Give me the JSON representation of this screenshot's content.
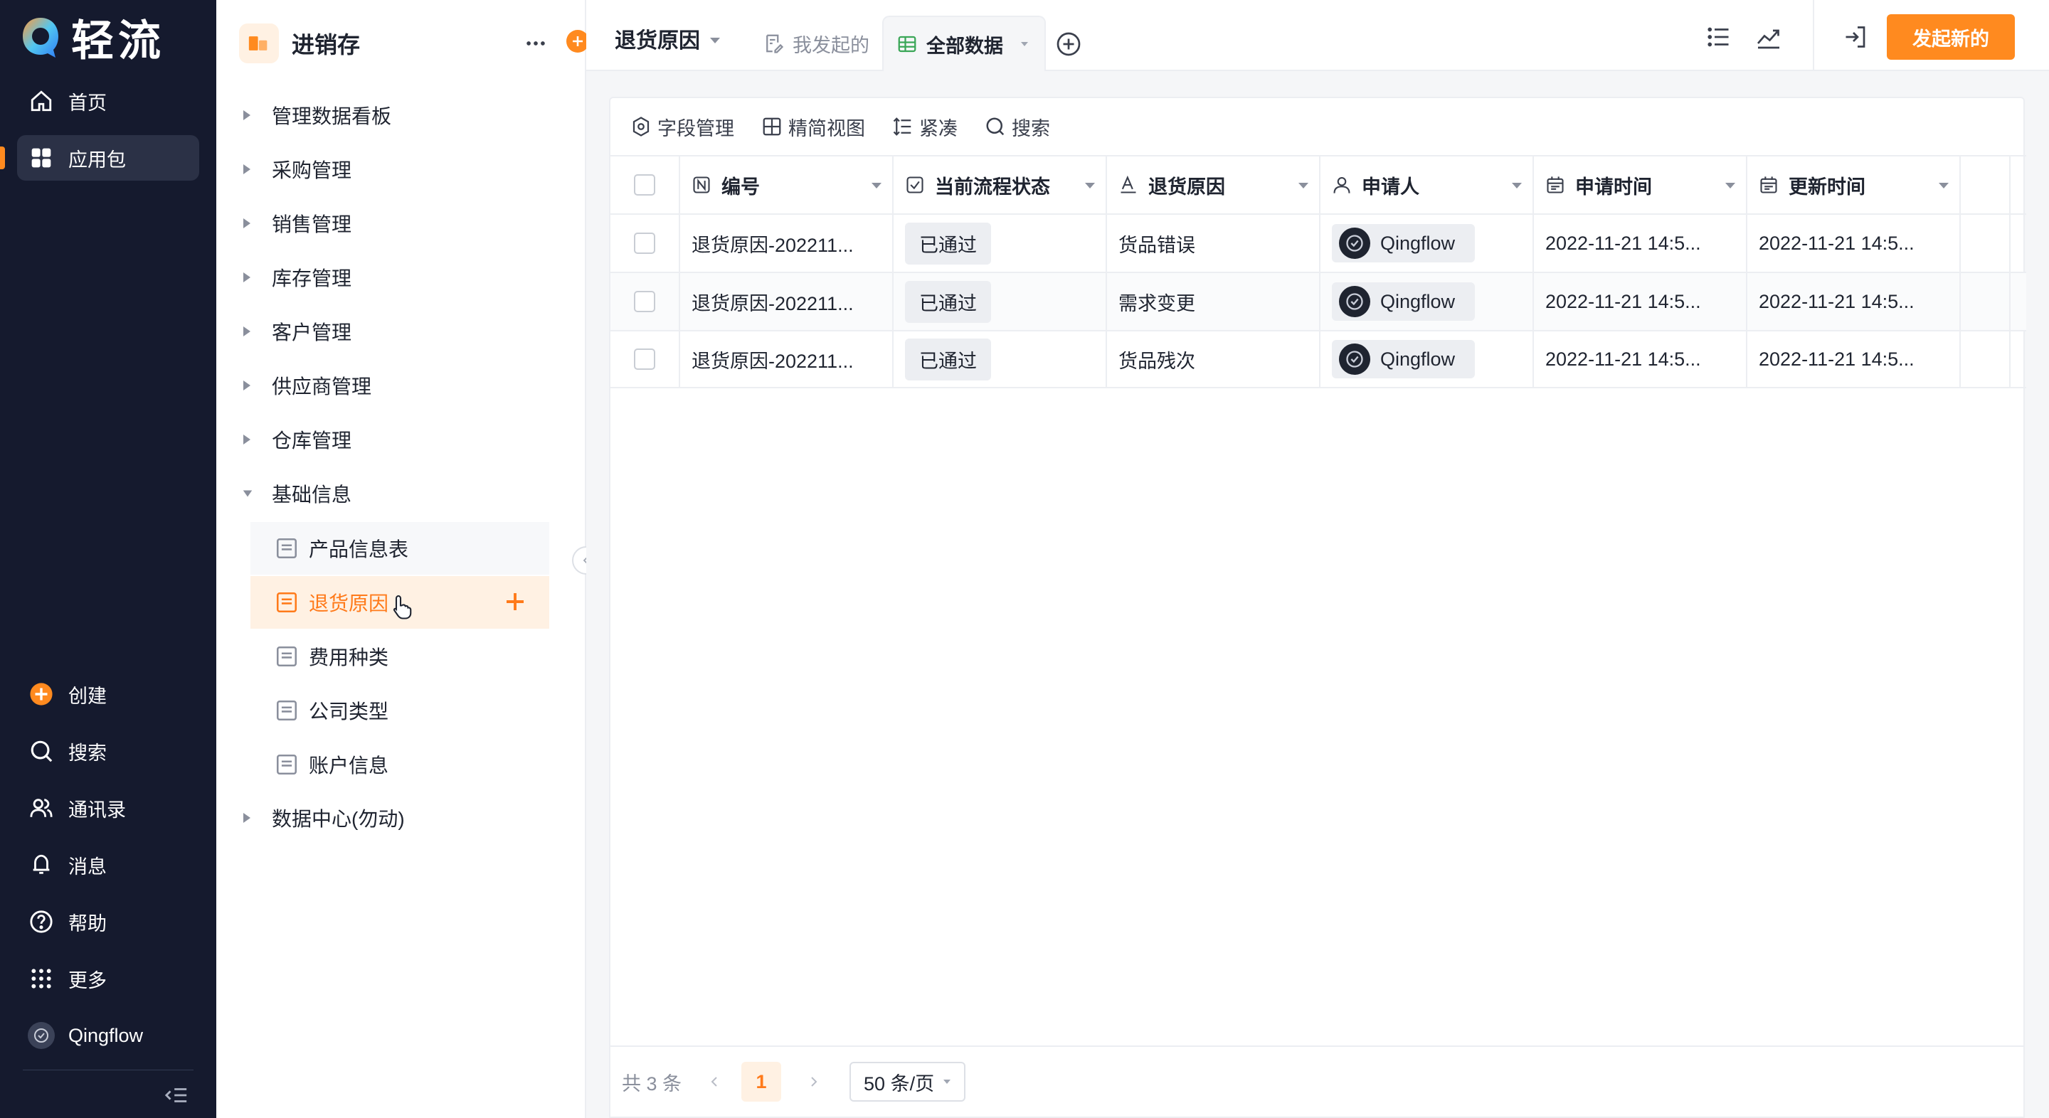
{
  "nav": {
    "logo_text": "轻流",
    "items": [
      {
        "label": "首页",
        "icon": "home-icon"
      },
      {
        "label": "应用包",
        "icon": "grid-apps-icon",
        "active": true
      },
      {
        "label": "创建",
        "icon": "plus-circle-icon"
      },
      {
        "label": "搜索",
        "icon": "search-icon"
      },
      {
        "label": "通讯录",
        "icon": "contacts-icon"
      },
      {
        "label": "消息",
        "icon": "bell-icon"
      },
      {
        "label": "帮助",
        "icon": "help-icon"
      },
      {
        "label": "更多",
        "icon": "dots-grid-icon"
      },
      {
        "label": "Qingflow",
        "icon": "avatar"
      }
    ]
  },
  "app": {
    "name": "进销存",
    "groups": [
      {
        "label": "管理数据看板"
      },
      {
        "label": "采购管理"
      },
      {
        "label": "销售管理"
      },
      {
        "label": "库存管理"
      },
      {
        "label": "客户管理"
      },
      {
        "label": "供应商管理"
      },
      {
        "label": "仓库管理"
      },
      {
        "label": "基础信息",
        "expanded": true
      },
      {
        "label": "数据中心(勿动)"
      }
    ],
    "forms": [
      {
        "label": "产品信息表"
      },
      {
        "label": "退货原因",
        "active": true
      },
      {
        "label": "费用种类"
      },
      {
        "label": "公司类型"
      },
      {
        "label": "账户信息"
      }
    ]
  },
  "topbar": {
    "form_title": "退货原因",
    "tabs": [
      {
        "label": "我发起的"
      },
      {
        "label": "全部数据",
        "active": true
      }
    ],
    "primary_button": "发起新的"
  },
  "toolbar": {
    "field_manage": "字段管理",
    "simple_view": "精简视图",
    "compact": "紧凑",
    "search": "搜索"
  },
  "table": {
    "columns": [
      "编号",
      "当前流程状态",
      "退货原因",
      "申请人",
      "申请时间",
      "更新时间"
    ],
    "rows": [
      {
        "id": "退货原因-202211...",
        "status": "已通过",
        "reason": "货品错误",
        "applicant": "Qingflow",
        "apply_time": "2022-11-21 14:5...",
        "update_time": "2022-11-21 14:5..."
      },
      {
        "id": "退货原因-202211...",
        "status": "已通过",
        "reason": "需求变更",
        "applicant": "Qingflow",
        "apply_time": "2022-11-21 14:5...",
        "update_time": "2022-11-21 14:5..."
      },
      {
        "id": "退货原因-202211...",
        "status": "已通过",
        "reason": "货品残次",
        "applicant": "Qingflow",
        "apply_time": "2022-11-21 14:5...",
        "update_time": "2022-11-21 14:5..."
      }
    ]
  },
  "pager": {
    "total": "共 3 条",
    "current_page": "1",
    "page_size": "50 条/页"
  },
  "colors": {
    "accent": "#ff8a1f",
    "nav_bg": "#151a2e",
    "active_leaf_bg": "#fff1e3"
  }
}
